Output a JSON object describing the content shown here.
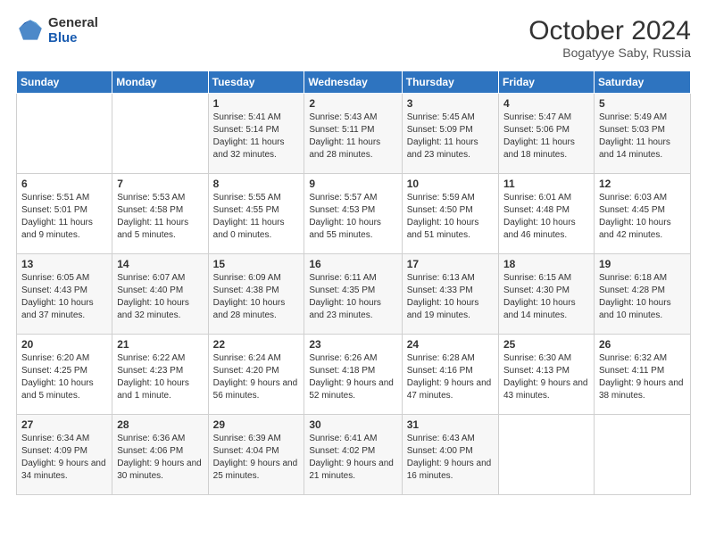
{
  "header": {
    "logo_general": "General",
    "logo_blue": "Blue",
    "title": "October 2024",
    "subtitle": "Bogatyye Saby, Russia"
  },
  "weekdays": [
    "Sunday",
    "Monday",
    "Tuesday",
    "Wednesday",
    "Thursday",
    "Friday",
    "Saturday"
  ],
  "weeks": [
    [
      {
        "day": "",
        "sunrise": "",
        "sunset": "",
        "daylight": ""
      },
      {
        "day": "",
        "sunrise": "",
        "sunset": "",
        "daylight": ""
      },
      {
        "day": "1",
        "sunrise": "Sunrise: 5:41 AM",
        "sunset": "Sunset: 5:14 PM",
        "daylight": "Daylight: 11 hours and 32 minutes."
      },
      {
        "day": "2",
        "sunrise": "Sunrise: 5:43 AM",
        "sunset": "Sunset: 5:11 PM",
        "daylight": "Daylight: 11 hours and 28 minutes."
      },
      {
        "day": "3",
        "sunrise": "Sunrise: 5:45 AM",
        "sunset": "Sunset: 5:09 PM",
        "daylight": "Daylight: 11 hours and 23 minutes."
      },
      {
        "day": "4",
        "sunrise": "Sunrise: 5:47 AM",
        "sunset": "Sunset: 5:06 PM",
        "daylight": "Daylight: 11 hours and 18 minutes."
      },
      {
        "day": "5",
        "sunrise": "Sunrise: 5:49 AM",
        "sunset": "Sunset: 5:03 PM",
        "daylight": "Daylight: 11 hours and 14 minutes."
      }
    ],
    [
      {
        "day": "6",
        "sunrise": "Sunrise: 5:51 AM",
        "sunset": "Sunset: 5:01 PM",
        "daylight": "Daylight: 11 hours and 9 minutes."
      },
      {
        "day": "7",
        "sunrise": "Sunrise: 5:53 AM",
        "sunset": "Sunset: 4:58 PM",
        "daylight": "Daylight: 11 hours and 5 minutes."
      },
      {
        "day": "8",
        "sunrise": "Sunrise: 5:55 AM",
        "sunset": "Sunset: 4:55 PM",
        "daylight": "Daylight: 11 hours and 0 minutes."
      },
      {
        "day": "9",
        "sunrise": "Sunrise: 5:57 AM",
        "sunset": "Sunset: 4:53 PM",
        "daylight": "Daylight: 10 hours and 55 minutes."
      },
      {
        "day": "10",
        "sunrise": "Sunrise: 5:59 AM",
        "sunset": "Sunset: 4:50 PM",
        "daylight": "Daylight: 10 hours and 51 minutes."
      },
      {
        "day": "11",
        "sunrise": "Sunrise: 6:01 AM",
        "sunset": "Sunset: 4:48 PM",
        "daylight": "Daylight: 10 hours and 46 minutes."
      },
      {
        "day": "12",
        "sunrise": "Sunrise: 6:03 AM",
        "sunset": "Sunset: 4:45 PM",
        "daylight": "Daylight: 10 hours and 42 minutes."
      }
    ],
    [
      {
        "day": "13",
        "sunrise": "Sunrise: 6:05 AM",
        "sunset": "Sunset: 4:43 PM",
        "daylight": "Daylight: 10 hours and 37 minutes."
      },
      {
        "day": "14",
        "sunrise": "Sunrise: 6:07 AM",
        "sunset": "Sunset: 4:40 PM",
        "daylight": "Daylight: 10 hours and 32 minutes."
      },
      {
        "day": "15",
        "sunrise": "Sunrise: 6:09 AM",
        "sunset": "Sunset: 4:38 PM",
        "daylight": "Daylight: 10 hours and 28 minutes."
      },
      {
        "day": "16",
        "sunrise": "Sunrise: 6:11 AM",
        "sunset": "Sunset: 4:35 PM",
        "daylight": "Daylight: 10 hours and 23 minutes."
      },
      {
        "day": "17",
        "sunrise": "Sunrise: 6:13 AM",
        "sunset": "Sunset: 4:33 PM",
        "daylight": "Daylight: 10 hours and 19 minutes."
      },
      {
        "day": "18",
        "sunrise": "Sunrise: 6:15 AM",
        "sunset": "Sunset: 4:30 PM",
        "daylight": "Daylight: 10 hours and 14 minutes."
      },
      {
        "day": "19",
        "sunrise": "Sunrise: 6:18 AM",
        "sunset": "Sunset: 4:28 PM",
        "daylight": "Daylight: 10 hours and 10 minutes."
      }
    ],
    [
      {
        "day": "20",
        "sunrise": "Sunrise: 6:20 AM",
        "sunset": "Sunset: 4:25 PM",
        "daylight": "Daylight: 10 hours and 5 minutes."
      },
      {
        "day": "21",
        "sunrise": "Sunrise: 6:22 AM",
        "sunset": "Sunset: 4:23 PM",
        "daylight": "Daylight: 10 hours and 1 minute."
      },
      {
        "day": "22",
        "sunrise": "Sunrise: 6:24 AM",
        "sunset": "Sunset: 4:20 PM",
        "daylight": "Daylight: 9 hours and 56 minutes."
      },
      {
        "day": "23",
        "sunrise": "Sunrise: 6:26 AM",
        "sunset": "Sunset: 4:18 PM",
        "daylight": "Daylight: 9 hours and 52 minutes."
      },
      {
        "day": "24",
        "sunrise": "Sunrise: 6:28 AM",
        "sunset": "Sunset: 4:16 PM",
        "daylight": "Daylight: 9 hours and 47 minutes."
      },
      {
        "day": "25",
        "sunrise": "Sunrise: 6:30 AM",
        "sunset": "Sunset: 4:13 PM",
        "daylight": "Daylight: 9 hours and 43 minutes."
      },
      {
        "day": "26",
        "sunrise": "Sunrise: 6:32 AM",
        "sunset": "Sunset: 4:11 PM",
        "daylight": "Daylight: 9 hours and 38 minutes."
      }
    ],
    [
      {
        "day": "27",
        "sunrise": "Sunrise: 6:34 AM",
        "sunset": "Sunset: 4:09 PM",
        "daylight": "Daylight: 9 hours and 34 minutes."
      },
      {
        "day": "28",
        "sunrise": "Sunrise: 6:36 AM",
        "sunset": "Sunset: 4:06 PM",
        "daylight": "Daylight: 9 hours and 30 minutes."
      },
      {
        "day": "29",
        "sunrise": "Sunrise: 6:39 AM",
        "sunset": "Sunset: 4:04 PM",
        "daylight": "Daylight: 9 hours and 25 minutes."
      },
      {
        "day": "30",
        "sunrise": "Sunrise: 6:41 AM",
        "sunset": "Sunset: 4:02 PM",
        "daylight": "Daylight: 9 hours and 21 minutes."
      },
      {
        "day": "31",
        "sunrise": "Sunrise: 6:43 AM",
        "sunset": "Sunset: 4:00 PM",
        "daylight": "Daylight: 9 hours and 16 minutes."
      },
      {
        "day": "",
        "sunrise": "",
        "sunset": "",
        "daylight": ""
      },
      {
        "day": "",
        "sunrise": "",
        "sunset": "",
        "daylight": ""
      }
    ]
  ]
}
